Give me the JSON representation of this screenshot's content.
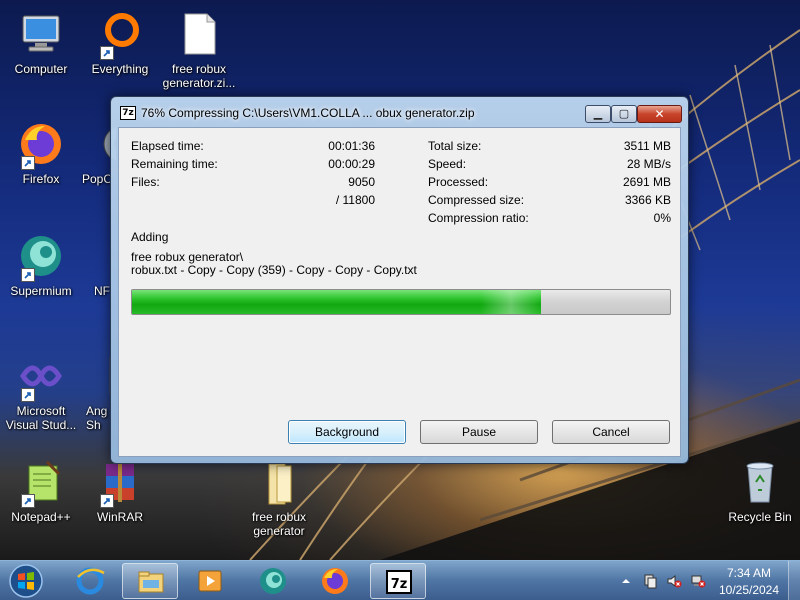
{
  "desktop": {
    "icons": [
      {
        "label": "Computer",
        "icon": "computer-icon"
      },
      {
        "label": "Everything",
        "icon": "everything-icon"
      },
      {
        "label": "free robux generator.zi...",
        "icon": "zip-file-icon"
      },
      {
        "label": "Firefox",
        "icon": "firefox-icon"
      },
      {
        "label": "PopC",
        "icon": "popcorn-icon"
      },
      {
        "label": "Supermium",
        "icon": "supermium-icon"
      },
      {
        "label": "NF",
        "icon": "app-icon"
      },
      {
        "label": "Microsoft Visual Stud...",
        "icon": "visual-studio-icon"
      },
      {
        "label": "Ang Sh",
        "icon": "app-icon"
      },
      {
        "label": "Notepad++",
        "icon": "notepadpp-icon"
      },
      {
        "label": "WinRAR",
        "icon": "winrar-icon"
      },
      {
        "label": "free robux generator",
        "icon": "folder-icon"
      },
      {
        "label": "Recycle Bin",
        "icon": "recycle-bin-icon"
      }
    ]
  },
  "dialog": {
    "title": "76% Compressing C:\\Users\\VM1.COLLA ... obux generator.zip",
    "title_icon": "7z",
    "elapsed_label": "Elapsed time:",
    "elapsed_value": "00:01:36",
    "remaining_label": "Remaining time:",
    "remaining_value": "00:00:29",
    "files_label": "Files:",
    "files_value": "9050",
    "files_total": "/ 11800",
    "total_size_label": "Total size:",
    "total_size_value": "3511 MB",
    "speed_label": "Speed:",
    "speed_value": "28 MB/s",
    "processed_label": "Processed:",
    "processed_value": "2691 MB",
    "compressed_label": "Compressed size:",
    "compressed_value": "3366 KB",
    "ratio_label": "Compression ratio:",
    "ratio_value": "0%",
    "adding_label": "Adding",
    "current_path_line1": "free robux generator\\",
    "current_path_line2": "robux.txt - Copy - Copy (359) - Copy - Copy - Copy.txt",
    "progress": 0.76,
    "buttons": {
      "background": "Background",
      "pause": "Pause",
      "cancel": "Cancel"
    }
  },
  "taskbar": {
    "items": [
      "start-orb",
      "ie-icon",
      "explorer-icon",
      "media-player-icon",
      "supermium-icon",
      "firefox-icon",
      "7zip-icon"
    ],
    "clock_time": "7:34 AM",
    "clock_date": "10/25/2024"
  }
}
